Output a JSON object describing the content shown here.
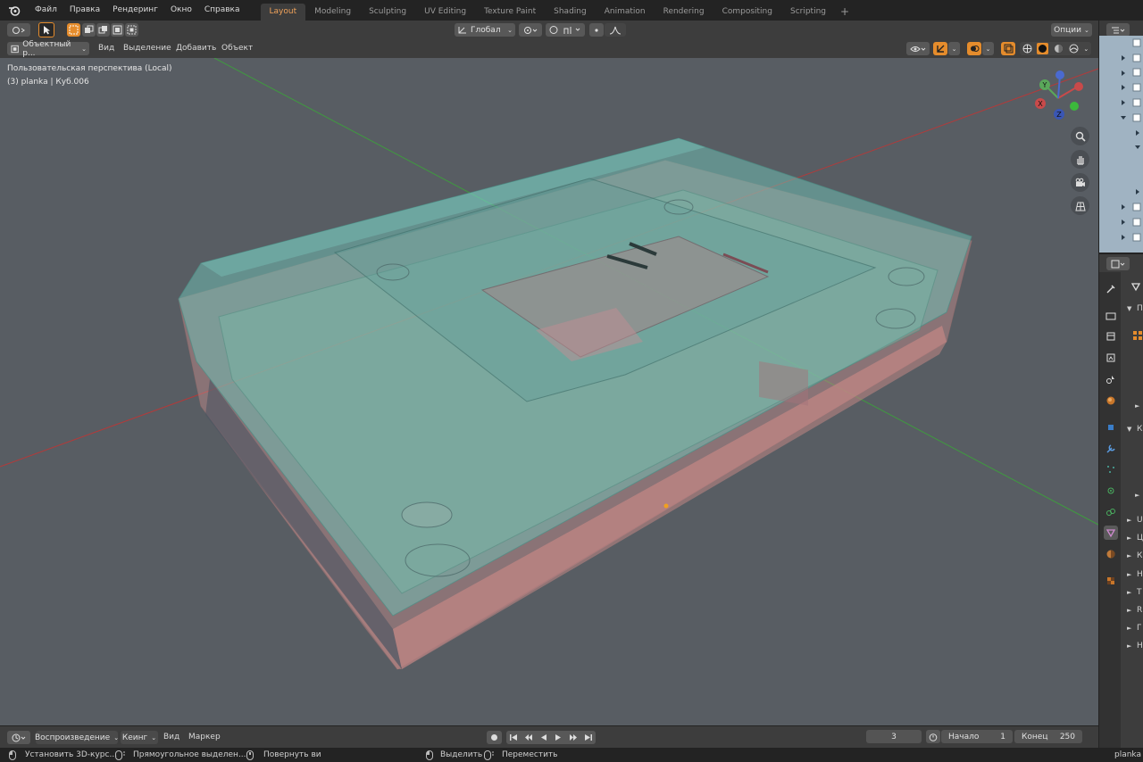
{
  "menu": {
    "items": [
      "Файл",
      "Правка",
      "Рендеринг",
      "Окно",
      "Справка"
    ]
  },
  "workspaces": {
    "tabs": [
      "Layout",
      "Modeling",
      "Sculpting",
      "UV Editing",
      "Texture Paint",
      "Shading",
      "Animation",
      "Rendering",
      "Compositing",
      "Scripting"
    ],
    "active": "Layout",
    "add": "+"
  },
  "header": {
    "transform_orientation": "Глобал",
    "options": "Опции",
    "mode": "Объектный р...",
    "menus": [
      "Вид",
      "Выделение",
      "Добавить",
      "Объект"
    ]
  },
  "viewport": {
    "perspective": "Пользовательская перспектива (Local)",
    "object_info": "(3) planka | Куб.006",
    "gizmo": {
      "x": "X",
      "y": "Y",
      "z": "Z"
    }
  },
  "properties": {
    "section_labels": [
      "П",
      "К"
    ],
    "list_labels": [
      "U",
      "Ц",
      "К",
      "Н",
      "Т",
      "R",
      "Г",
      "Н"
    ]
  },
  "timeline": {
    "playback": "Воспроизведение",
    "keying": "Кеинг",
    "view": "Вид",
    "marker": "Маркер",
    "current_frame": "3",
    "start_label": "Начало",
    "start": "1",
    "end_label": "Конец",
    "end": "250"
  },
  "statusbar": {
    "set_cursor": "Установить 3D-курс...",
    "box_select": "Прямоугольное выделен...",
    "rotate": "Повернуть ви",
    "select": "Выделить",
    "move": "Переместить",
    "right": "planka"
  },
  "colors": {
    "accent": "#e58c2c",
    "active_tab": "#f0a25a",
    "viewport_bg": "#585d63",
    "axis_x": "#c83c3c",
    "axis_y": "#3c9a3c"
  }
}
